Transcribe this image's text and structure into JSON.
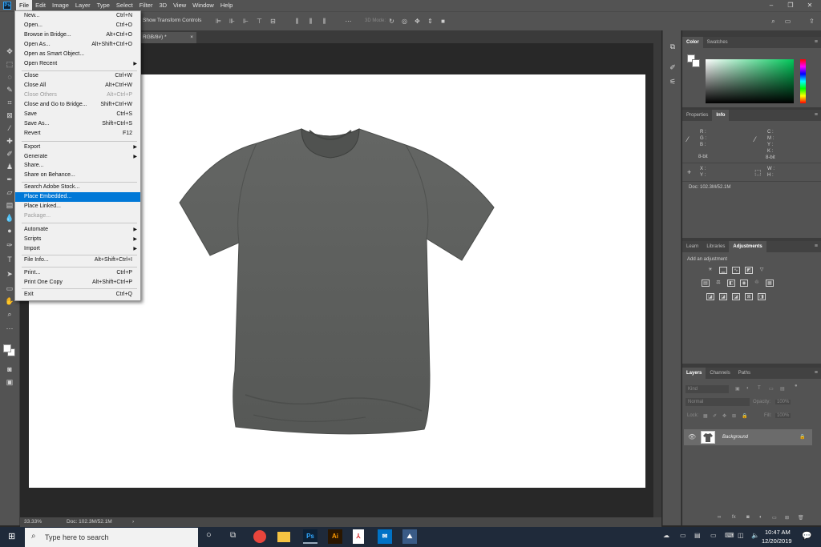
{
  "app": {
    "logo": "Ps",
    "document_tab": "RGB/8#) *"
  },
  "menubar": {
    "items": [
      "File",
      "Edit",
      "Image",
      "Layer",
      "Type",
      "Select",
      "Filter",
      "3D",
      "View",
      "Window",
      "Help"
    ]
  },
  "options": {
    "show_transform_controls": "Show Transform Controls",
    "mode_3d": "3D Mode:"
  },
  "file_menu": {
    "items": [
      {
        "label": "New...",
        "shortcut": "Ctrl+N"
      },
      {
        "label": "Open...",
        "shortcut": "Ctrl+O"
      },
      {
        "label": "Browse in Bridge...",
        "shortcut": "Alt+Ctrl+O"
      },
      {
        "label": "Open As...",
        "shortcut": "Alt+Shift+Ctrl+O"
      },
      {
        "label": "Open as Smart Object...",
        "shortcut": ""
      },
      {
        "label": "Open Recent",
        "shortcut": ""
      },
      {
        "label": "Close",
        "shortcut": "Ctrl+W"
      },
      {
        "label": "Close All",
        "shortcut": "Alt+Ctrl+W"
      },
      {
        "label": "Close Others",
        "shortcut": "Alt+Ctrl+P"
      },
      {
        "label": "Close and Go to Bridge...",
        "shortcut": "Shift+Ctrl+W"
      },
      {
        "label": "Save",
        "shortcut": "Ctrl+S"
      },
      {
        "label": "Save As...",
        "shortcut": "Shift+Ctrl+S"
      },
      {
        "label": "Revert",
        "shortcut": "F12"
      },
      {
        "label": "Export",
        "shortcut": ""
      },
      {
        "label": "Generate",
        "shortcut": ""
      },
      {
        "label": "Share...",
        "shortcut": ""
      },
      {
        "label": "Share on Behance...",
        "shortcut": ""
      },
      {
        "label": "Search Adobe Stock...",
        "shortcut": ""
      },
      {
        "label": "Place Embedded...",
        "shortcut": ""
      },
      {
        "label": "Place Linked...",
        "shortcut": ""
      },
      {
        "label": "Package...",
        "shortcut": ""
      },
      {
        "label": "Automate",
        "shortcut": ""
      },
      {
        "label": "Scripts",
        "shortcut": ""
      },
      {
        "label": "Import",
        "shortcut": ""
      },
      {
        "label": "File Info...",
        "shortcut": "Alt+Shift+Ctrl+I"
      },
      {
        "label": "Print...",
        "shortcut": "Ctrl+P"
      },
      {
        "label": "Print One Copy",
        "shortcut": "Alt+Shift+Ctrl+P"
      },
      {
        "label": "Exit",
        "shortcut": "Ctrl+Q"
      }
    ]
  },
  "status": {
    "zoom": "33.33%",
    "doc": "Doc: 102.3M/52.1M"
  },
  "panels": {
    "color_tabs": [
      "Color",
      "Swatches"
    ],
    "info_tabs": [
      "Properties",
      "Info"
    ],
    "info": {
      "rgb": [
        "R :",
        "G :",
        "B :"
      ],
      "cmyk": [
        "C :",
        "M :",
        "Y :",
        "K :"
      ],
      "bit_left": "8-bit",
      "bit_right": "8-bit",
      "xy": [
        "X :",
        "Y :"
      ],
      "wh": [
        "W :",
        "H :"
      ],
      "doc": "Doc: 102.3M/52.1M"
    },
    "adj_tabs": [
      "Learn",
      "Libraries",
      "Adjustments"
    ],
    "add_adjustment": "Add an adjustment",
    "layers_tabs": [
      "Layers",
      "Channels",
      "Paths"
    ],
    "layers": {
      "kind": "Kind",
      "blend": "Normal",
      "opacity_label": "Opacity:",
      "opacity": "100%",
      "lock_label": "Lock:",
      "fill_label": "Fill:",
      "fill": "100%",
      "layer_name": "Background"
    }
  },
  "taskbar": {
    "search_placeholder": "Type here to search",
    "time": "10:47 AM",
    "date": "12/20/2019",
    "apps": [
      "Ps",
      "Ai"
    ]
  },
  "colors": {
    "highlight": "#0078d7",
    "ps_blue": "#31a8ff",
    "ai_orange": "#ff9a00"
  }
}
